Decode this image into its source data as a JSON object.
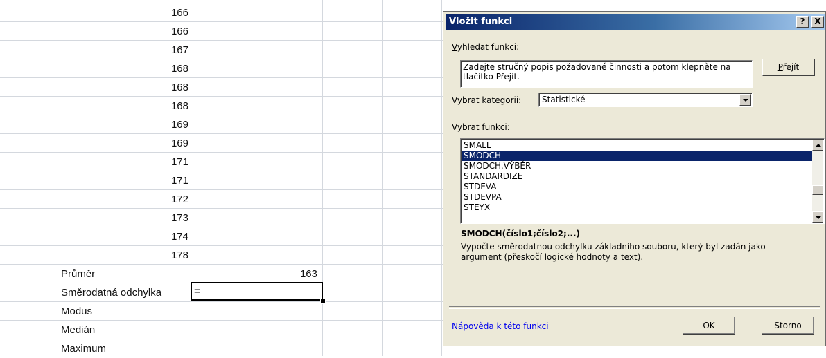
{
  "sheet": {
    "numbers": [
      "166",
      "166",
      "167",
      "168",
      "168",
      "168",
      "169",
      "169",
      "171",
      "171",
      "172",
      "173",
      "174",
      "178"
    ],
    "labels": {
      "prumer": "Průměr",
      "smerodatna": "Směrodatná odchylka",
      "modus": "Modus",
      "median": "Medián",
      "maximum": "Maximum"
    },
    "prumer_value": "163",
    "active_cell_value": "="
  },
  "dialog": {
    "title": "Vložit funkci",
    "help_btn": "?",
    "close_btn": "X",
    "search_label_ul": "V",
    "search_label_rest": "yhledat funkci:",
    "search_text": "Zadejte stručný popis požadované činnosti a potom klepněte na tlačítko Přejít.",
    "go_button_ul": "P",
    "go_button_rest": "řejít",
    "category_label_pre": "Vybrat ",
    "category_label_ul": "k",
    "category_label_post": "ategorii:",
    "category_value": "Statistické",
    "function_label_pre": "Vybrat ",
    "function_label_ul": "f",
    "function_label_post": "unkci:",
    "functions": [
      "SMALL",
      "SMODCH",
      "SMODCH.VÝBĚR",
      "STANDARDIZE",
      "STDEVA",
      "STDEVPA",
      "STEYX"
    ],
    "selected_function": "SMODCH",
    "syntax": "SMODCH(číslo1;číslo2;...)",
    "description": "Vypočte směrodatnou odchylku základního souboru, který byl zadán jako argument (přeskočí logické hodnoty a text).",
    "help_link": "Nápověda k této funkci",
    "ok_label": "OK",
    "cancel_label": "Storno"
  },
  "colors": {
    "title_bar": "#0a246a",
    "selection": "#0a246a",
    "dialog_bg": "#ece9d8",
    "link": "#0000ee",
    "grid": "#d4d8de"
  }
}
